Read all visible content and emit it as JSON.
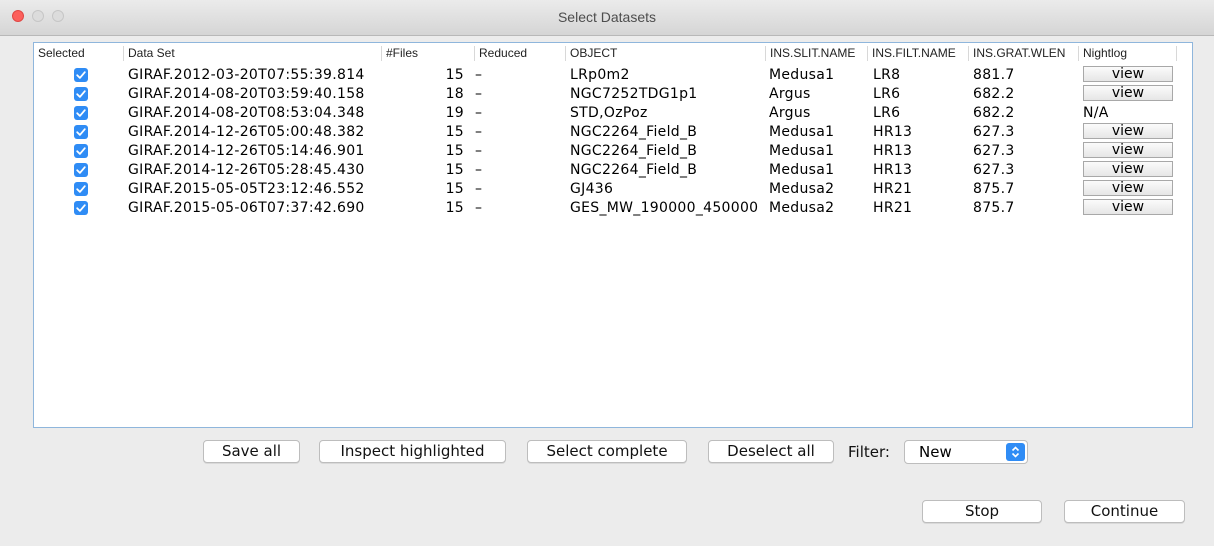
{
  "window": {
    "title": "Select Datasets"
  },
  "columns": [
    "Selected",
    "Data Set",
    "#Files",
    "Reduced",
    "OBJECT",
    "INS.SLIT.NAME",
    "INS.FILT.NAME",
    "INS.GRAT.WLEN",
    "Nightlog"
  ],
  "rows": [
    {
      "dataset": "GIRAF.2012-03-20T07:55:39.814",
      "files": "15",
      "reduced": "–",
      "object": "LRp0m2",
      "slit": "Medusa1",
      "filt": "LR8",
      "wlen": "881.7",
      "nightlog": "view"
    },
    {
      "dataset": "GIRAF.2014-08-20T03:59:40.158",
      "files": "18",
      "reduced": "–",
      "object": "NGC7252TDG1p1",
      "slit": "Argus",
      "filt": "LR6",
      "wlen": "682.2",
      "nightlog": "view"
    },
    {
      "dataset": "GIRAF.2014-08-20T08:53:04.348",
      "files": "19",
      "reduced": "–",
      "object": "STD,OzPoz",
      "slit": "Argus",
      "filt": "LR6",
      "wlen": "682.2",
      "nightlog": "N/A"
    },
    {
      "dataset": "GIRAF.2014-12-26T05:00:48.382",
      "files": "15",
      "reduced": "–",
      "object": "NGC2264_Field_B",
      "slit": "Medusa1",
      "filt": "HR13",
      "wlen": "627.3",
      "nightlog": "view"
    },
    {
      "dataset": "GIRAF.2014-12-26T05:14:46.901",
      "files": "15",
      "reduced": "–",
      "object": "NGC2264_Field_B",
      "slit": "Medusa1",
      "filt": "HR13",
      "wlen": "627.3",
      "nightlog": "view"
    },
    {
      "dataset": "GIRAF.2014-12-26T05:28:45.430",
      "files": "15",
      "reduced": "–",
      "object": "NGC2264_Field_B",
      "slit": "Medusa1",
      "filt": "HR13",
      "wlen": "627.3",
      "nightlog": "view"
    },
    {
      "dataset": "GIRAF.2015-05-05T23:12:46.552",
      "files": "15",
      "reduced": "–",
      "object": "GJ436",
      "slit": "Medusa2",
      "filt": "HR21",
      "wlen": "875.7",
      "nightlog": "view"
    },
    {
      "dataset": "GIRAF.2015-05-06T07:37:42.690",
      "files": "15",
      "reduced": "–",
      "object": "GES_MW_190000_450000",
      "slit": "Medusa2",
      "filt": "HR21",
      "wlen": "875.7",
      "nightlog": "view"
    }
  ],
  "buttons": {
    "save_all": "Save all",
    "inspect_highlighted": "Inspect highlighted",
    "select_complete": "Select complete",
    "deselect_all": "Deselect all",
    "stop": "Stop",
    "continue": "Continue"
  },
  "filter": {
    "label": "Filter:",
    "value": "New"
  },
  "colors": {
    "accent": "#2f8cf5",
    "table_border": "#8fb6dc",
    "window_bg": "#ececec"
  }
}
